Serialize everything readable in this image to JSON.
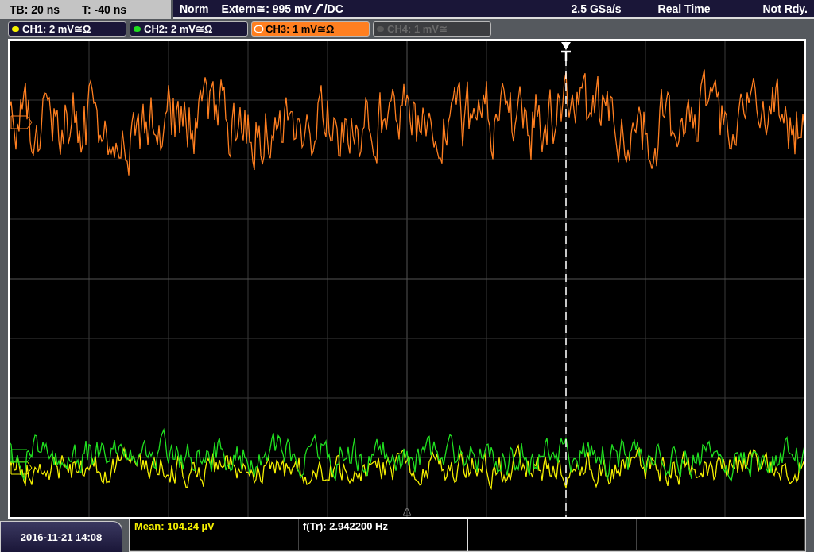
{
  "status_bar": {
    "timebase": "TB: 20 ns",
    "trigger_time": "T: -40 ns",
    "mode": "Norm",
    "trigger_source": "Extern≅: 995 mV",
    "trigger_coupling": "/DC",
    "sample_rate": "2.5 GSa/s",
    "acquisition": "Real Time",
    "state": "Not Rdy."
  },
  "channels": [
    {
      "label": "CH1: 2 mV≅Ω",
      "color": "#f5f000",
      "selected": false,
      "enabled": true
    },
    {
      "label": "CH2: 2 mV≅Ω",
      "color": "#20e020",
      "selected": false,
      "enabled": true
    },
    {
      "label": "CH3: 1 mV≅Ω",
      "color": "#ff7f20",
      "selected": true,
      "enabled": true
    },
    {
      "label": "CH4: 1 mV≅",
      "color": "#5a5a5a",
      "selected": false,
      "enabled": false
    }
  ],
  "measurements": [
    {
      "text": "Mean: 104.24 µV",
      "color": "#f5f000"
    },
    {
      "text": "f(Tr): 2.942200 Hz",
      "color": "#ffffff"
    }
  ],
  "date": "2016-11-21 14:08"
}
